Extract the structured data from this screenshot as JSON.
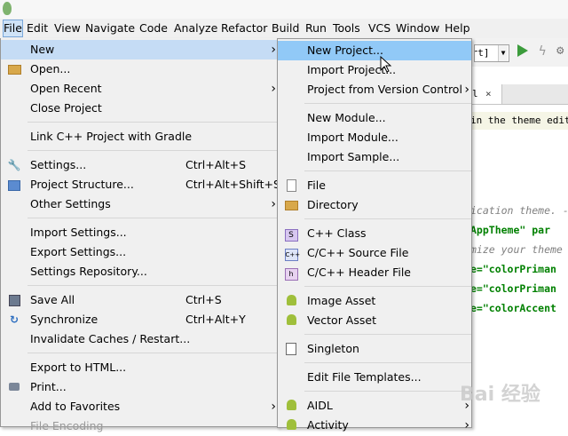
{
  "menubar": [
    "File",
    "Edit",
    "View",
    "Navigate",
    "Code",
    "Analyze",
    "Refactor",
    "Build",
    "Run",
    "Tools",
    "VCS",
    "Window",
    "Help"
  ],
  "toolbar": {
    "run_config": "ort]"
  },
  "editor": {
    "tab_label": "l",
    "tab_close": "×",
    "notice": "in the theme edito",
    "lines": [
      {
        "text": "ication theme. -",
        "kind": "cm"
      },
      {
        "text": "AppTheme\" par",
        "kind": "mix1"
      },
      {
        "text": "mize your theme",
        "kind": "cm"
      },
      {
        "text": "e=\"colorPriman",
        "kind": "mix2"
      },
      {
        "text": "e=\"colorPriman",
        "kind": "mix2"
      },
      {
        "text": "e=\"colorAccent",
        "kind": "mix2"
      }
    ]
  },
  "file_menu": [
    {
      "label": "New",
      "shortcut": "",
      "submenu": true,
      "icon": "",
      "highlight": true
    },
    {
      "label": "Open...",
      "shortcut": "",
      "submenu": false,
      "icon": "folder-icon"
    },
    {
      "label": "Open Recent",
      "shortcut": "",
      "submenu": true,
      "icon": ""
    },
    {
      "label": "Close Project",
      "shortcut": "",
      "submenu": false,
      "icon": ""
    },
    {
      "sep": true
    },
    {
      "label": "Link C++ Project with Gradle",
      "shortcut": "",
      "submenu": false,
      "icon": ""
    },
    {
      "sep": true
    },
    {
      "label": "Settings...",
      "shortcut": "Ctrl+Alt+S",
      "submenu": false,
      "icon": "wrench-icon"
    },
    {
      "label": "Project Structure...",
      "shortcut": "Ctrl+Alt+Shift+S",
      "submenu": false,
      "icon": "project-structure-icon"
    },
    {
      "label": "Other Settings",
      "shortcut": "",
      "submenu": true,
      "icon": ""
    },
    {
      "sep": true
    },
    {
      "label": "Import Settings...",
      "shortcut": "",
      "submenu": false,
      "icon": ""
    },
    {
      "label": "Export Settings...",
      "shortcut": "",
      "submenu": false,
      "icon": ""
    },
    {
      "label": "Settings Repository...",
      "shortcut": "",
      "submenu": false,
      "icon": ""
    },
    {
      "sep": true
    },
    {
      "label": "Save All",
      "shortcut": "Ctrl+S",
      "submenu": false,
      "icon": "save-icon"
    },
    {
      "label": "Synchronize",
      "shortcut": "Ctrl+Alt+Y",
      "submenu": false,
      "icon": "sync-icon"
    },
    {
      "label": "Invalidate Caches / Restart...",
      "shortcut": "",
      "submenu": false,
      "icon": ""
    },
    {
      "sep": true
    },
    {
      "label": "Export to HTML...",
      "shortcut": "",
      "submenu": false,
      "icon": ""
    },
    {
      "label": "Print...",
      "shortcut": "",
      "submenu": false,
      "icon": "print-icon"
    },
    {
      "label": "Add to Favorites",
      "shortcut": "",
      "submenu": true,
      "icon": ""
    },
    {
      "label": "File Encoding",
      "shortcut": "",
      "submenu": false,
      "icon": "",
      "disabled": true
    }
  ],
  "new_menu": [
    {
      "label": "New Project...",
      "submenu": false,
      "icon": "",
      "highlight": true
    },
    {
      "label": "Import Project...",
      "submenu": false,
      "icon": ""
    },
    {
      "label": "Project from Version Control",
      "submenu": true,
      "icon": ""
    },
    {
      "sep": true
    },
    {
      "label": "New Module...",
      "submenu": false,
      "icon": ""
    },
    {
      "label": "Import Module...",
      "submenu": false,
      "icon": ""
    },
    {
      "label": "Import Sample...",
      "submenu": false,
      "icon": ""
    },
    {
      "sep": true
    },
    {
      "label": "File",
      "submenu": false,
      "icon": "file-icon"
    },
    {
      "label": "Directory",
      "submenu": false,
      "icon": "folder-icon"
    },
    {
      "sep": true
    },
    {
      "label": "C++ Class",
      "submenu": false,
      "icon": "cpp-class-icon"
    },
    {
      "label": "C/C++ Source File",
      "submenu": false,
      "icon": "cpp-source-icon"
    },
    {
      "label": "C/C++ Header File",
      "submenu": false,
      "icon": "cpp-header-icon"
    },
    {
      "sep": true
    },
    {
      "label": "Image Asset",
      "submenu": false,
      "icon": "android-icon"
    },
    {
      "label": "Vector Asset",
      "submenu": false,
      "icon": "android-icon"
    },
    {
      "sep": true
    },
    {
      "label": "Singleton",
      "submenu": false,
      "icon": "singleton-icon"
    },
    {
      "sep": true
    },
    {
      "label": "Edit File Templates...",
      "submenu": false,
      "icon": ""
    },
    {
      "sep": true
    },
    {
      "label": "AIDL",
      "submenu": true,
      "icon": "android-icon"
    },
    {
      "label": "Activity",
      "submenu": true,
      "icon": "android-icon"
    }
  ],
  "watermark": "Bai 经验",
  "colors": {
    "menu_bg": "#f0f0f0",
    "highlight": "#91c9f7",
    "android": "#9fbf3b",
    "run": "#3c9c3c"
  }
}
